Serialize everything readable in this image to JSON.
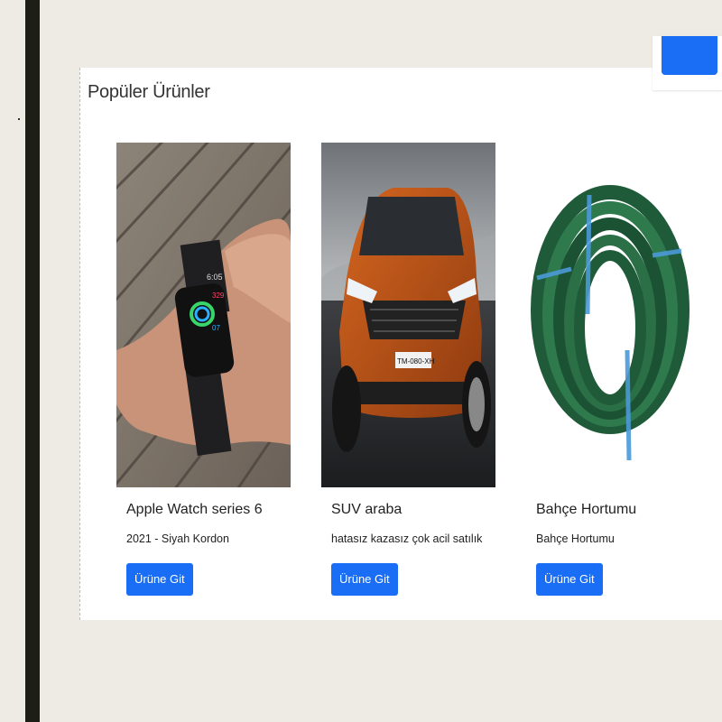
{
  "section": {
    "title": "Popüler Ürünler"
  },
  "products": [
    {
      "title": "Apple Watch series 6",
      "text": "2021 - Siyah Kordon",
      "button": "Ürüne Git",
      "image": "smartwatch-on-wrist-photo"
    },
    {
      "title": "SUV araba",
      "text": "hatasız kazasız çok acil satılık",
      "button": "Ürüne Git",
      "image": "orange-suv-photo"
    },
    {
      "title": "Bahçe Hortumu",
      "text": "Bahçe Hortumu",
      "button": "Ürüne Git",
      "image": "green-garden-hose-photo"
    }
  ],
  "colors": {
    "background": "#edebe4",
    "accent": "#1a6ef5",
    "sidebar": "#1d1f14"
  }
}
